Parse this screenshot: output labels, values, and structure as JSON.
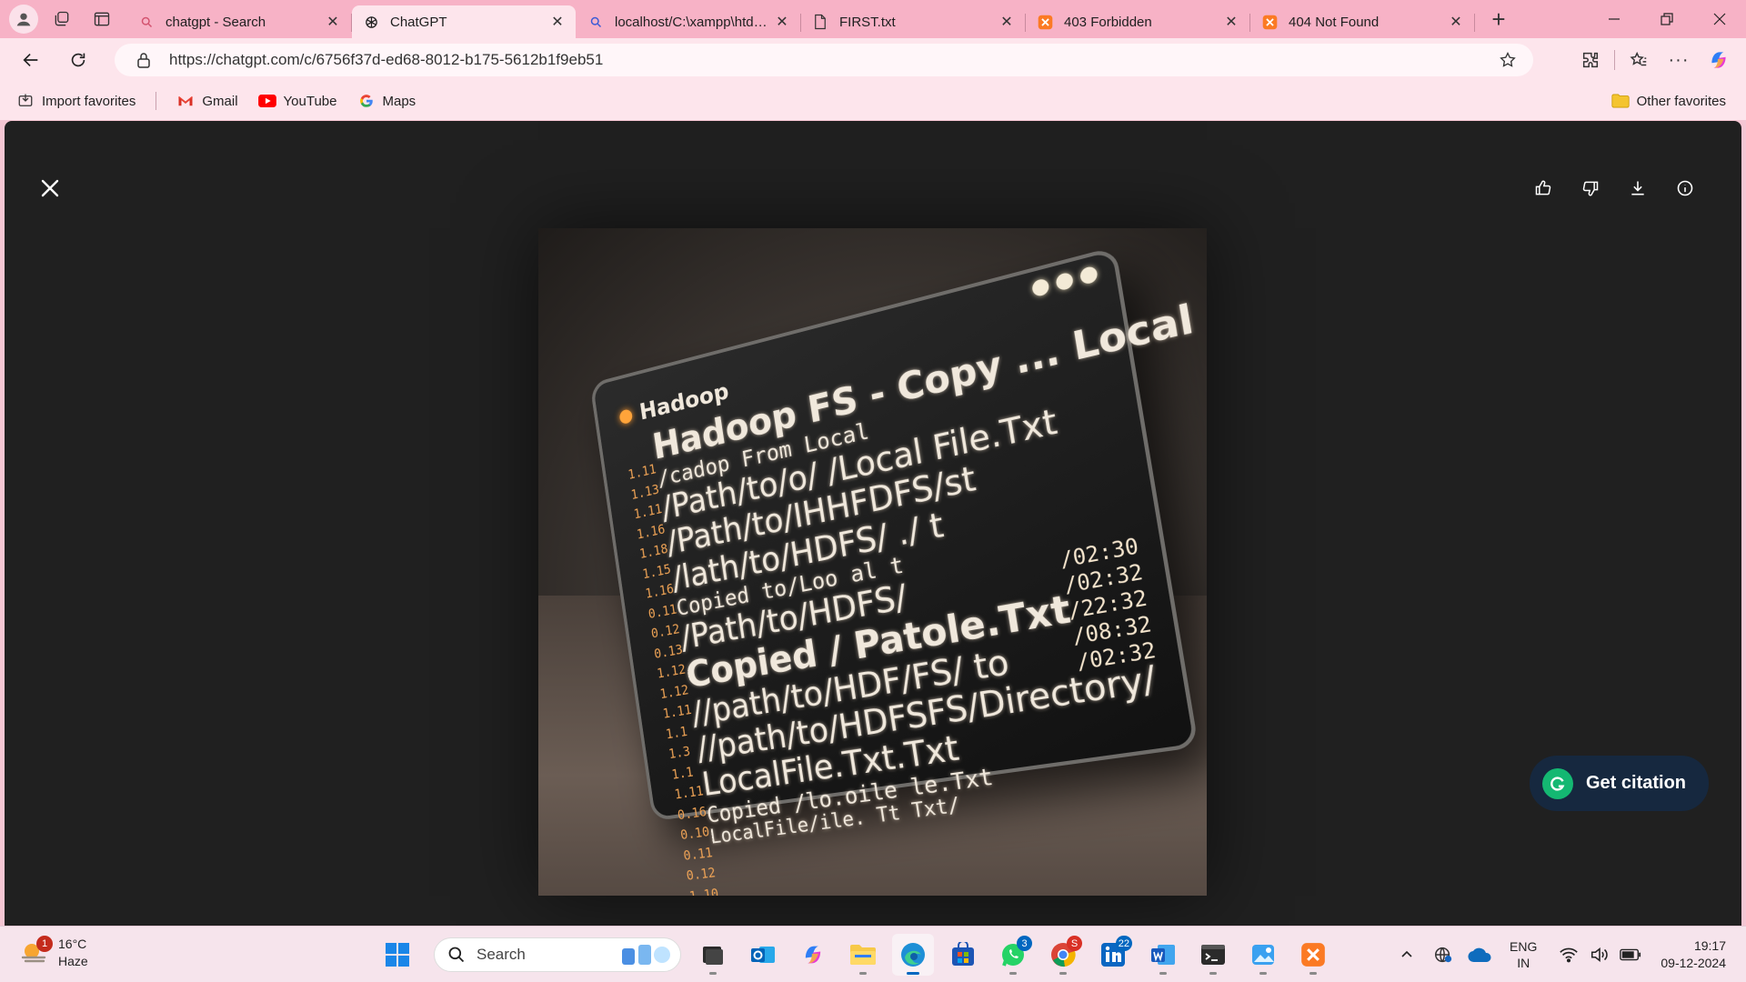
{
  "browser": {
    "tabs": [
      {
        "title": "chatgpt - Search",
        "icon": "search-icon",
        "active": false
      },
      {
        "title": "ChatGPT",
        "icon": "openai-icon",
        "active": true
      },
      {
        "title": "localhost/C:\\xampp\\htdocs",
        "icon": "search-icon",
        "active": false
      },
      {
        "title": "FIRST.txt",
        "icon": "file-icon",
        "active": false
      },
      {
        "title": "403 Forbidden",
        "icon": "xampp-icon",
        "active": false
      },
      {
        "title": "404 Not Found",
        "icon": "xampp-icon",
        "active": false
      }
    ],
    "url": "https://chatgpt.com/c/6756f37d-ed68-8012-b175-5612b1f9eb51",
    "favorites": [
      {
        "label": "Import favorites",
        "icon": "import-icon"
      },
      {
        "label": "Gmail",
        "icon": "gmail-icon"
      },
      {
        "label": "YouTube",
        "icon": "youtube-icon"
      },
      {
        "label": "Maps",
        "icon": "google-icon"
      }
    ],
    "other_favorites": "Other favorites"
  },
  "image": {
    "header": "Hadoop",
    "lines": [
      {
        "text": "Hadoop FS - Copy ... Local",
        "size": "big"
      },
      {
        "text": "/cadop From Local",
        "size": "small"
      },
      {
        "text": "/Path/to/o/ /Local File.Txt",
        "size": "med"
      },
      {
        "text": "/Path/to/IHHFDFS/st",
        "size": "med"
      },
      {
        "text": "/lath/to/HDFS/ ./ t",
        "size": "med"
      },
      {
        "text": "Copied to/Loo al   t",
        "size": "small"
      },
      {
        "text": "/Path/to/HDFS/",
        "size": "med"
      },
      {
        "text": "Copied / Patole.Txt",
        "size": "big"
      },
      {
        "text": "//path/to/HDF/FS/ to",
        "size": "med"
      },
      {
        "text": "//path/to/HDFSFS/Directory/",
        "size": "med"
      },
      {
        "text": "LocalFile.Txt.Txt",
        "size": "med"
      },
      {
        "text": "Copied /lo.oile le.Txt",
        "size": "small"
      },
      {
        "text": "LocalFile/ile. Tt Txt/",
        "size": "xsmall"
      }
    ],
    "gutter": [
      "1.11",
      "1.13",
      "1.11",
      "1.16",
      "1.18",
      "1.15",
      "1.16",
      "0.11",
      "0.12",
      "0.13",
      "1.12",
      "1.12",
      "1.11",
      "1.1",
      "1.3",
      "1.1",
      "1.11",
      "0.16",
      "0.10",
      "0.11",
      "0.12",
      "1.10"
    ],
    "timestamps": [
      "/02:30",
      "/02:32",
      "/22:32",
      "/08:32",
      "/02:32"
    ]
  },
  "viewer": {
    "citation_label": "Get citation"
  },
  "taskbar": {
    "weather_temp": "16°C",
    "weather_desc": "Haze",
    "weather_badge": "1",
    "search_label": "Search",
    "apps": [
      {
        "name": "file-explorer-dark",
        "badge": ""
      },
      {
        "name": "outlook",
        "badge": ""
      },
      {
        "name": "copilot",
        "badge": ""
      },
      {
        "name": "folder",
        "badge": ""
      },
      {
        "name": "edge",
        "badge": ""
      },
      {
        "name": "store",
        "badge": ""
      },
      {
        "name": "whatsapp",
        "badge": "3"
      },
      {
        "name": "chrome",
        "badge": "S"
      },
      {
        "name": "linkedin",
        "badge": "22"
      },
      {
        "name": "word",
        "badge": ""
      },
      {
        "name": "terminal",
        "badge": ""
      },
      {
        "name": "photos",
        "badge": ""
      },
      {
        "name": "xampp",
        "badge": ""
      }
    ],
    "lang_top": "ENG",
    "lang_bottom": "IN",
    "time": "19:17",
    "date": "09-12-2024"
  }
}
